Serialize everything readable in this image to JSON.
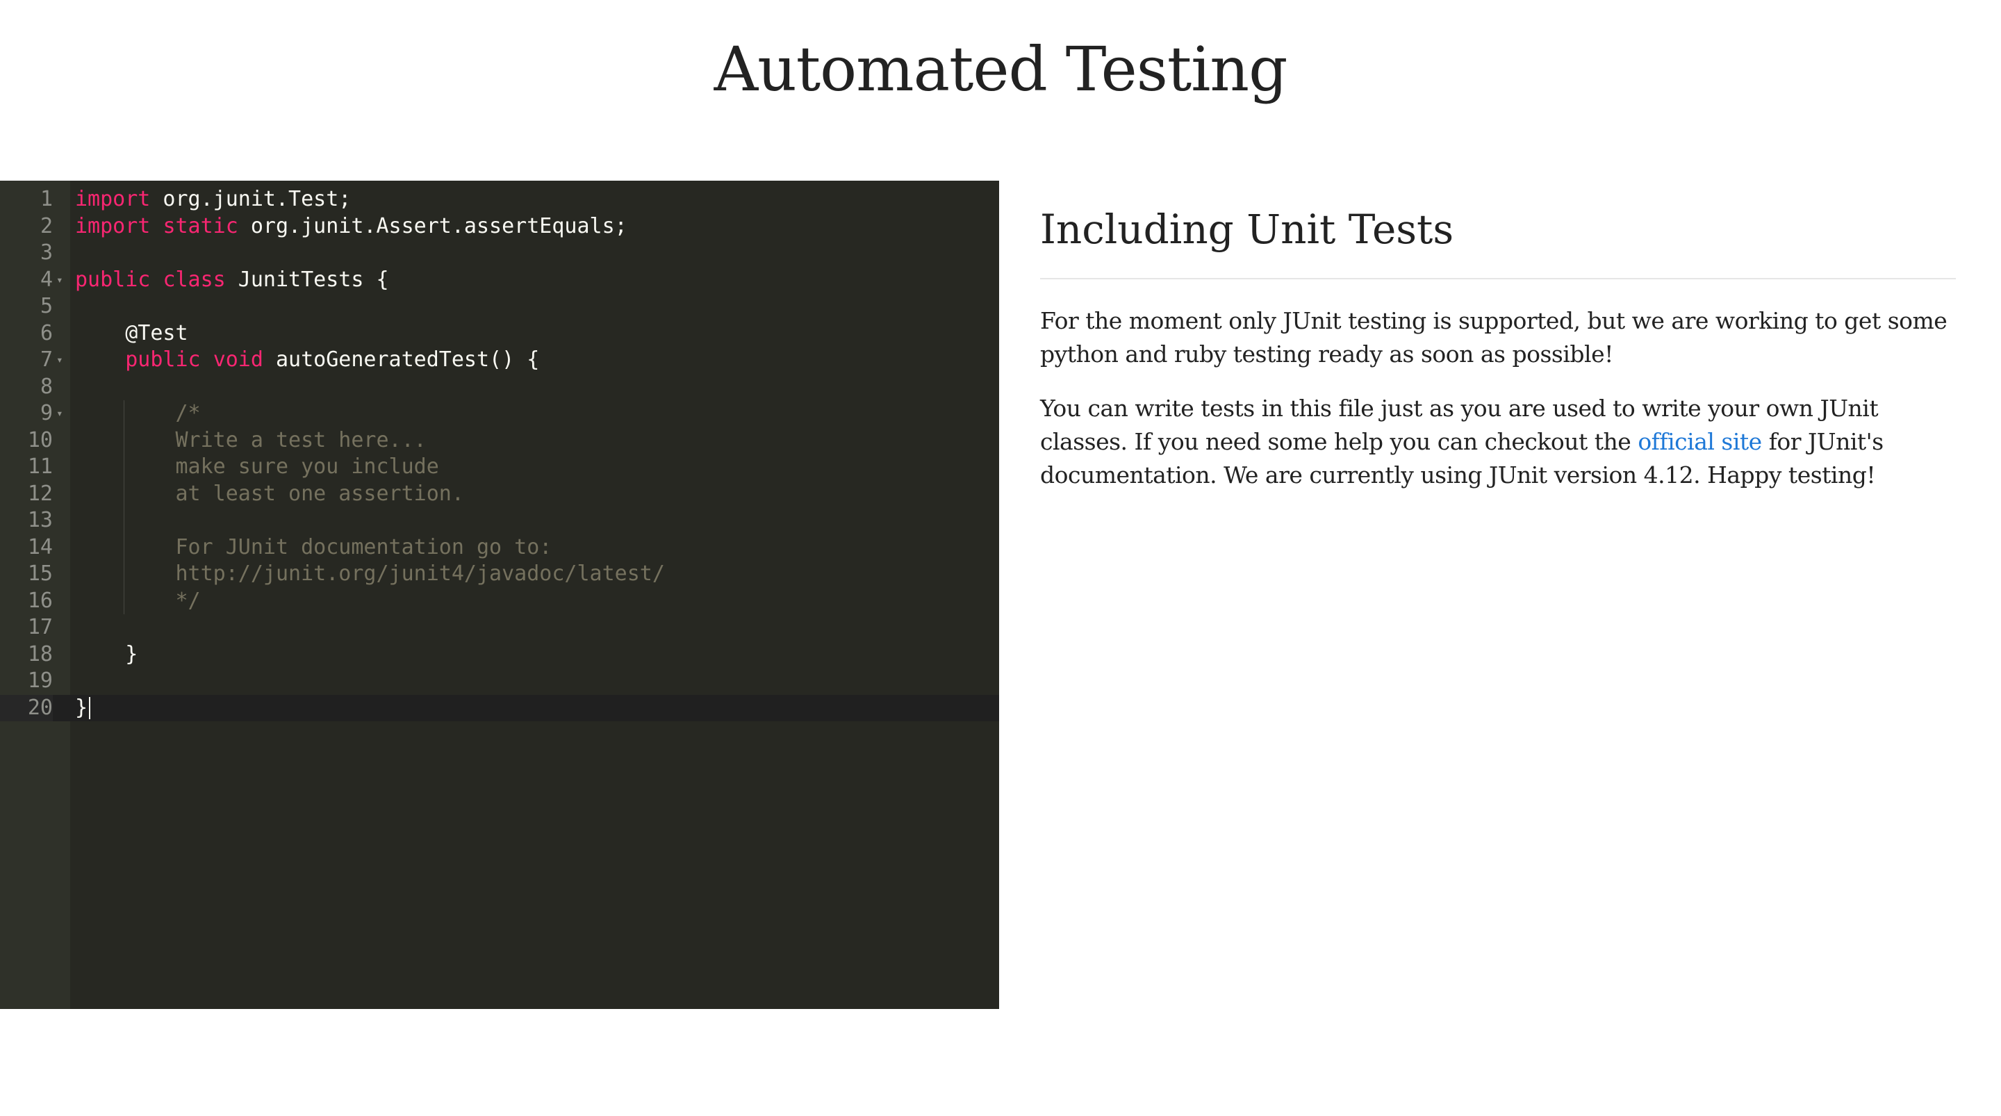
{
  "page": {
    "title": "Automated Testing"
  },
  "editor": {
    "theme_colors": {
      "background": "#272822",
      "gutter": "#2f3129",
      "keyword": "#f92672",
      "comment": "#75715e",
      "text": "#f8f8f2",
      "line_number": "#8f908a"
    },
    "active_line": 20,
    "lines": [
      {
        "n": "1",
        "fold": false,
        "tokens": [
          [
            "kw",
            "import"
          ],
          [
            "plain",
            " org.junit.Test;"
          ]
        ]
      },
      {
        "n": "2",
        "fold": false,
        "tokens": [
          [
            "kw",
            "import"
          ],
          [
            "plain",
            " "
          ],
          [
            "kw",
            "static"
          ],
          [
            "plain",
            " org.junit.Assert.assertEquals;"
          ]
        ]
      },
      {
        "n": "3",
        "fold": false,
        "tokens": []
      },
      {
        "n": "4",
        "fold": true,
        "tokens": [
          [
            "kw",
            "public"
          ],
          [
            "plain",
            " "
          ],
          [
            "kw",
            "class"
          ],
          [
            "plain",
            " JunitTests {"
          ]
        ]
      },
      {
        "n": "5",
        "fold": false,
        "tokens": []
      },
      {
        "n": "6",
        "fold": false,
        "tokens": [
          [
            "plain",
            "    @Test"
          ]
        ]
      },
      {
        "n": "7",
        "fold": true,
        "tokens": [
          [
            "plain",
            "    "
          ],
          [
            "kw",
            "public"
          ],
          [
            "plain",
            " "
          ],
          [
            "kw",
            "void"
          ],
          [
            "plain",
            " autoGeneratedTest() {"
          ]
        ]
      },
      {
        "n": "8",
        "fold": false,
        "tokens": []
      },
      {
        "n": "9",
        "fold": true,
        "tokens": [
          [
            "plain",
            "        "
          ],
          [
            "cm",
            "/*"
          ]
        ]
      },
      {
        "n": "10",
        "fold": false,
        "tokens": [
          [
            "plain",
            "        "
          ],
          [
            "cm",
            "Write a test here..."
          ]
        ]
      },
      {
        "n": "11",
        "fold": false,
        "tokens": [
          [
            "plain",
            "        "
          ],
          [
            "cm",
            "make sure you include"
          ]
        ]
      },
      {
        "n": "12",
        "fold": false,
        "tokens": [
          [
            "plain",
            "        "
          ],
          [
            "cm",
            "at least one assertion."
          ]
        ]
      },
      {
        "n": "13",
        "fold": false,
        "tokens": []
      },
      {
        "n": "14",
        "fold": false,
        "tokens": [
          [
            "plain",
            "        "
          ],
          [
            "cm",
            "For JUnit documentation go to:"
          ]
        ]
      },
      {
        "n": "15",
        "fold": false,
        "tokens": [
          [
            "plain",
            "        "
          ],
          [
            "cm",
            "http://junit.org/junit4/javadoc/latest/"
          ]
        ]
      },
      {
        "n": "16",
        "fold": false,
        "tokens": [
          [
            "plain",
            "        "
          ],
          [
            "cm",
            "*/"
          ]
        ]
      },
      {
        "n": "17",
        "fold": false,
        "tokens": []
      },
      {
        "n": "18",
        "fold": false,
        "tokens": [
          [
            "plain",
            "    }"
          ]
        ]
      },
      {
        "n": "19",
        "fold": false,
        "tokens": []
      },
      {
        "n": "20",
        "fold": false,
        "tokens": [
          [
            "plain",
            "}"
          ]
        ]
      }
    ]
  },
  "doc": {
    "heading": "Including Unit Tests",
    "para1": "For the moment only JUnit testing is supported, but we are working to get some python and ruby testing ready as soon as possible!",
    "para2_before": "You can write tests in this file just as you are used to write your own JUnit classes. If you need some help you can checkout the ",
    "para2_link": "official site",
    "para2_after": " for JUnit's documentation. We are currently using JUnit version 4.12. Happy testing!",
    "link_color": "#1e78d7"
  }
}
